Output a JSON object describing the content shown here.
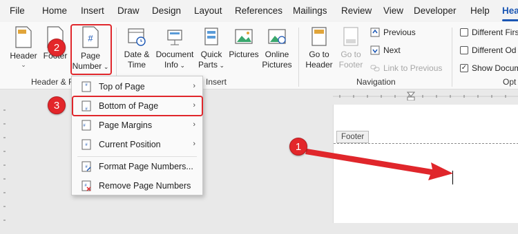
{
  "tabs": [
    "File",
    "Home",
    "Insert",
    "Draw",
    "Design",
    "Layout",
    "References",
    "Mailings",
    "Review",
    "View",
    "Developer",
    "Help",
    "Hea"
  ],
  "ribbon": {
    "header_label": "Header",
    "footer_label": "Footer",
    "page_number_line1": "Page",
    "page_number_line2": "Number",
    "group_header_footer": "Header & F",
    "date_time_line1": "Date &",
    "date_time_line2": "Time",
    "document_info_line1": "Document",
    "document_info_line2": "Info",
    "quick_parts_line1": "Quick",
    "quick_parts_line2": "Parts",
    "pictures_label": "Pictures",
    "online_pictures_line1": "Online",
    "online_pictures_line2": "Pictures",
    "group_insert": "Insert",
    "goto_header_line1": "Go to",
    "goto_header_line2": "Header",
    "goto_footer_line1": "Go to",
    "goto_footer_line2": "Footer",
    "previous_label": "Previous",
    "next_label": "Next",
    "link_previous_label": "Link to Previous",
    "group_navigation": "Navigation",
    "diff_first_label": "Different Firs",
    "diff_odd_label": "Different Od",
    "show_doc_label": "Show Docum",
    "show_doc_checked": true,
    "group_options": "Opt"
  },
  "menu": {
    "items": [
      {
        "label": "Top of Page",
        "submenu": true
      },
      {
        "label": "Bottom of Page",
        "submenu": true
      },
      {
        "label": "Page Margins",
        "submenu": true
      },
      {
        "label": "Current Position",
        "submenu": true
      },
      {
        "label": "Format Page Numbers...",
        "submenu": false
      },
      {
        "label": "Remove Page Numbers",
        "submenu": false
      }
    ]
  },
  "document": {
    "footer_tag": "Footer"
  },
  "badges": [
    "1",
    "2",
    "3"
  ],
  "colors": {
    "accent": "#1a56b4",
    "annotation_red": "#e0262b"
  }
}
